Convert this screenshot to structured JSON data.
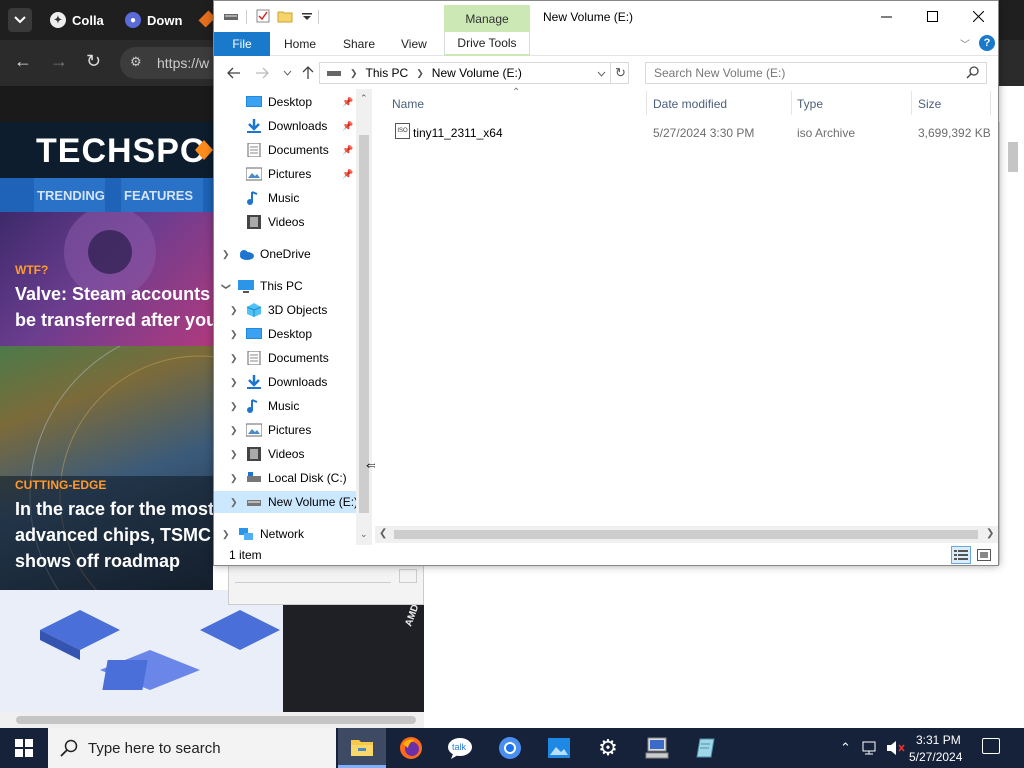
{
  "browser": {
    "tabs": [
      {
        "label": "Colla",
        "icon": "collab-favicon"
      },
      {
        "label": "Down",
        "icon": "download-favicon"
      }
    ],
    "address_text": "https://w",
    "site": {
      "logo": "TECHSPO",
      "nav": [
        "TRENDING",
        "FEATURES"
      ],
      "articles": [
        {
          "tag": "WTF?",
          "title_line1": "Valve: Steam accounts ca",
          "title_line2": "be transferred after you d"
        },
        {
          "tag": "CUTTING-EDGE",
          "title_line1": "In the race for the most",
          "title_line2": "advanced chips, TSMC",
          "title_line3": "shows off roadmap"
        }
      ],
      "promo_badge": "AMD"
    }
  },
  "explorer": {
    "title": "New Volume (E:)",
    "contextual_tab_header": "Manage",
    "ribbon_tabs": [
      "File",
      "Home",
      "Share",
      "View",
      "Drive Tools"
    ],
    "help_glyph": "?",
    "breadcrumb": [
      "This PC",
      "New Volume (E:)"
    ],
    "search_placeholder": "Search New Volume (E:)",
    "nav_items": [
      {
        "label": "Desktop",
        "icon": "desktop-icon",
        "pinned": true
      },
      {
        "label": "Downloads",
        "icon": "downloads-icon",
        "pinned": true
      },
      {
        "label": "Documents",
        "icon": "documents-icon",
        "pinned": true
      },
      {
        "label": "Pictures",
        "icon": "pictures-icon",
        "pinned": true
      },
      {
        "label": "Music",
        "icon": "music-icon",
        "pinned": false
      },
      {
        "label": "Videos",
        "icon": "videos-icon",
        "pinned": false
      },
      {
        "label": "OneDrive",
        "icon": "onedrive-icon",
        "pinned": false
      },
      {
        "label": "This PC",
        "icon": "this-pc-icon",
        "pinned": false
      },
      {
        "label": "3D Objects",
        "icon": "3d-objects-icon",
        "pinned": false
      },
      {
        "label": "Desktop",
        "icon": "desktop-icon",
        "pinned": false
      },
      {
        "label": "Documents",
        "icon": "documents-icon",
        "pinned": false
      },
      {
        "label": "Downloads",
        "icon": "downloads-icon",
        "pinned": false
      },
      {
        "label": "Music",
        "icon": "music-icon",
        "pinned": false
      },
      {
        "label": "Pictures",
        "icon": "pictures-icon",
        "pinned": false
      },
      {
        "label": "Videos",
        "icon": "videos-icon",
        "pinned": false
      },
      {
        "label": "Local Disk (C:)",
        "icon": "local-disk-icon",
        "pinned": false
      },
      {
        "label": "New Volume (E:)",
        "icon": "drive-icon",
        "pinned": false,
        "selected": true
      },
      {
        "label": "Network",
        "icon": "network-icon",
        "pinned": false
      }
    ],
    "columns": [
      "Name",
      "Date modified",
      "Type",
      "Size"
    ],
    "files": [
      {
        "name": "tiny11_2311_x64",
        "date_modified": "5/27/2024 3:30 PM",
        "type": "iso Archive",
        "size": "3,699,392 KB",
        "icon": "iso-file-icon"
      }
    ],
    "file_icon_text": "ISO",
    "status": "1 item"
  },
  "taskbar": {
    "search_placeholder": "Type here to search",
    "apps": [
      "file-explorer-icon",
      "firefox-icon",
      "talk-icon",
      "chrome-icon",
      "photos-icon",
      "settings-icon",
      "computer-icon",
      "notepad-icon"
    ],
    "clock_time": "3:31 PM",
    "clock_date": "5/27/2024"
  },
  "colors": {
    "file_tab": "#1979ca",
    "manage_tab": "#cce8b5",
    "selection": "#cce8ff",
    "taskbar": "#16213a",
    "site_nav": "#1e63b7",
    "accent_orange": "#ff9a2e"
  }
}
